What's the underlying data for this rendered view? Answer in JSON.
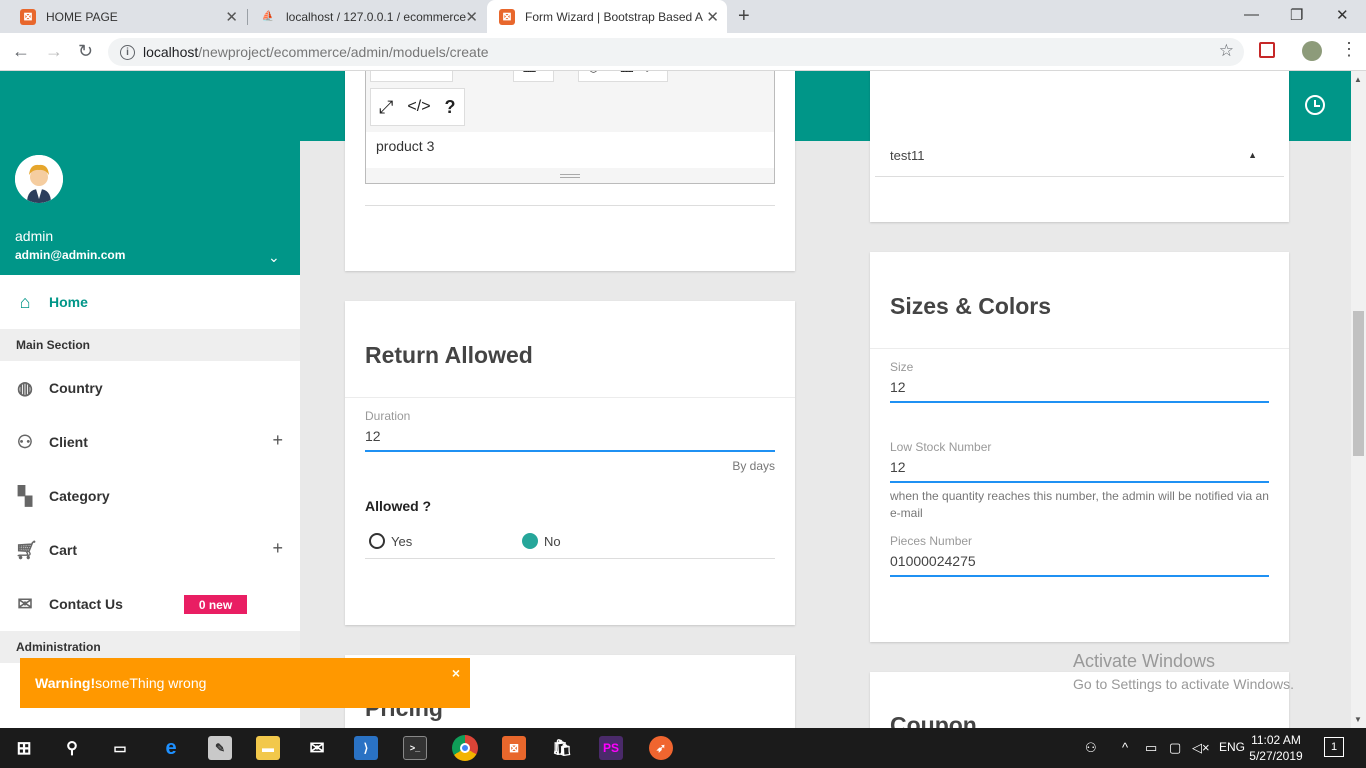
{
  "browser": {
    "tabs": [
      {
        "title": "HOME PAGE"
      },
      {
        "title": "localhost / 127.0.0.1 / ecommerce"
      },
      {
        "title": "Form Wizard | Bootstrap Based A"
      }
    ],
    "url_host": "localhost",
    "url_path": "/newproject/ecommerce/admin/moduels/create"
  },
  "sidebar": {
    "user_name": "admin",
    "user_email": "admin@admin.com",
    "home_label": "Home",
    "main_section_header": "Main Section",
    "items": [
      {
        "label": "Country"
      },
      {
        "label": "Client"
      },
      {
        "label": "Category"
      },
      {
        "label": "Cart"
      },
      {
        "label": "Contact Us"
      }
    ],
    "contact_badge": "0 new",
    "administration_header": "Administration"
  },
  "editor": {
    "content": "product 3"
  },
  "return_card": {
    "title": "Return Allowed",
    "duration_label": "Duration",
    "duration_value": "12",
    "duration_help": "By days",
    "allowed_label": "Allowed ?",
    "option_yes": "Yes",
    "option_no": "No",
    "selected": "No"
  },
  "select_card": {
    "value": "test11"
  },
  "sizes_card": {
    "title": "Sizes & Colors",
    "size_label": "Size",
    "size_value": "12",
    "low_stock_label": "Low Stock Number",
    "low_stock_value": "12",
    "low_stock_help": "when the quantity reaches this number, the admin will be notified via an e-mail",
    "pieces_label": "Pieces Number",
    "pieces_value": "01000024275"
  },
  "next_cards": {
    "pricing_title": "Pricing",
    "coupon_title": "Coupon"
  },
  "alert": {
    "strong": "Warning!",
    "message": " someThing wrong",
    "close": "×"
  },
  "watermark": {
    "line1": "Activate Windows",
    "line2": "Go to Settings to activate Windows."
  },
  "taskbar": {
    "language": "ENG",
    "time": "11:02 AM",
    "date": "5/27/2019",
    "notification_count": "1"
  },
  "colors": {
    "primary": "#009688",
    "accent_line": "#1f91f3",
    "badge": "#e91e63",
    "warning": "#ff9800"
  }
}
